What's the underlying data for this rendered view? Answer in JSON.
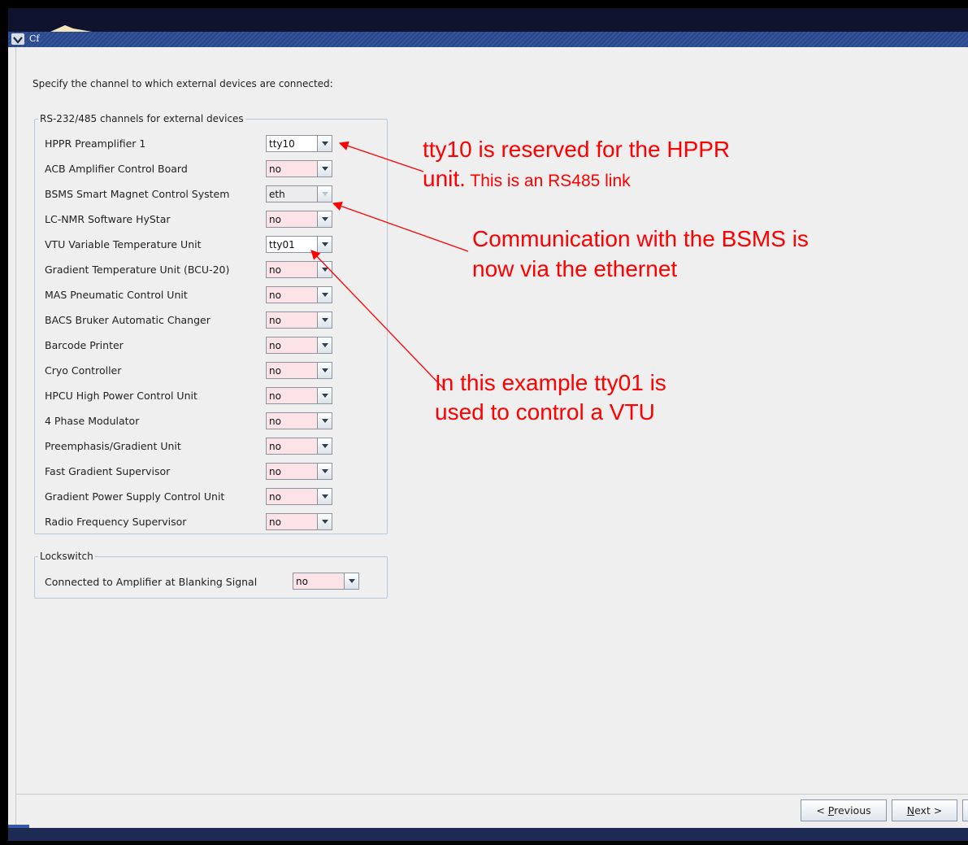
{
  "window": {
    "title": "Cf"
  },
  "instruction": "Specify the channel to which external devices are connected:",
  "rs_group": {
    "title": "RS-232/485 channels for external devices",
    "rows": [
      {
        "label": "HPPR Preamplifier 1",
        "value": "tty10"
      },
      {
        "label": "ACB Amplifier Control Board",
        "value": "no"
      },
      {
        "label": "BSMS Smart Magnet Control System",
        "value": "eth"
      },
      {
        "label": "LC-NMR Software HyStar",
        "value": "no"
      },
      {
        "label": "VTU Variable Temperature Unit",
        "value": "tty01"
      },
      {
        "label": "Gradient Temperature Unit (BCU-20)",
        "value": "no"
      },
      {
        "label": "MAS Pneumatic Control Unit",
        "value": "no"
      },
      {
        "label": "BACS Bruker Automatic Changer",
        "value": "no"
      },
      {
        "label": "Barcode Printer",
        "value": "no"
      },
      {
        "label": "Cryo Controller",
        "value": "no"
      },
      {
        "label": "HPCU High Power Control Unit",
        "value": "no"
      },
      {
        "label": "4 Phase Modulator",
        "value": "no"
      },
      {
        "label": "Preemphasis/Gradient Unit",
        "value": "no"
      },
      {
        "label": "Fast Gradient Supervisor",
        "value": "no"
      },
      {
        "label": "Gradient Power Supply Control Unit",
        "value": "no"
      },
      {
        "label": "Radio Frequency Supervisor",
        "value": "no"
      }
    ]
  },
  "lock_group": {
    "title": "Lockswitch",
    "label": "Connected to Amplifier at Blanking Signal",
    "value": "no"
  },
  "buttons": {
    "previous_prefix": "< ",
    "previous_mnemonic": "P",
    "previous_rest": "revious",
    "next_mnemonic": "N",
    "next_rest": "ext >"
  },
  "annotations": {
    "hppr_line1": "tty10 is reserved for the HPPR",
    "hppr_line2_big": "unit.",
    "hppr_line2_small": " This is an RS485 link",
    "bsms_line1": "Communication with the BSMS is",
    "bsms_line2": "now via the ethernet",
    "vtu_line1": "In this example tty01 is",
    "vtu_line2": "used to control a VTU"
  },
  "colors": {
    "annotation": "#ff0000",
    "combo_value_bg": "#fbe3e8",
    "titlebar": "#33549a"
  }
}
